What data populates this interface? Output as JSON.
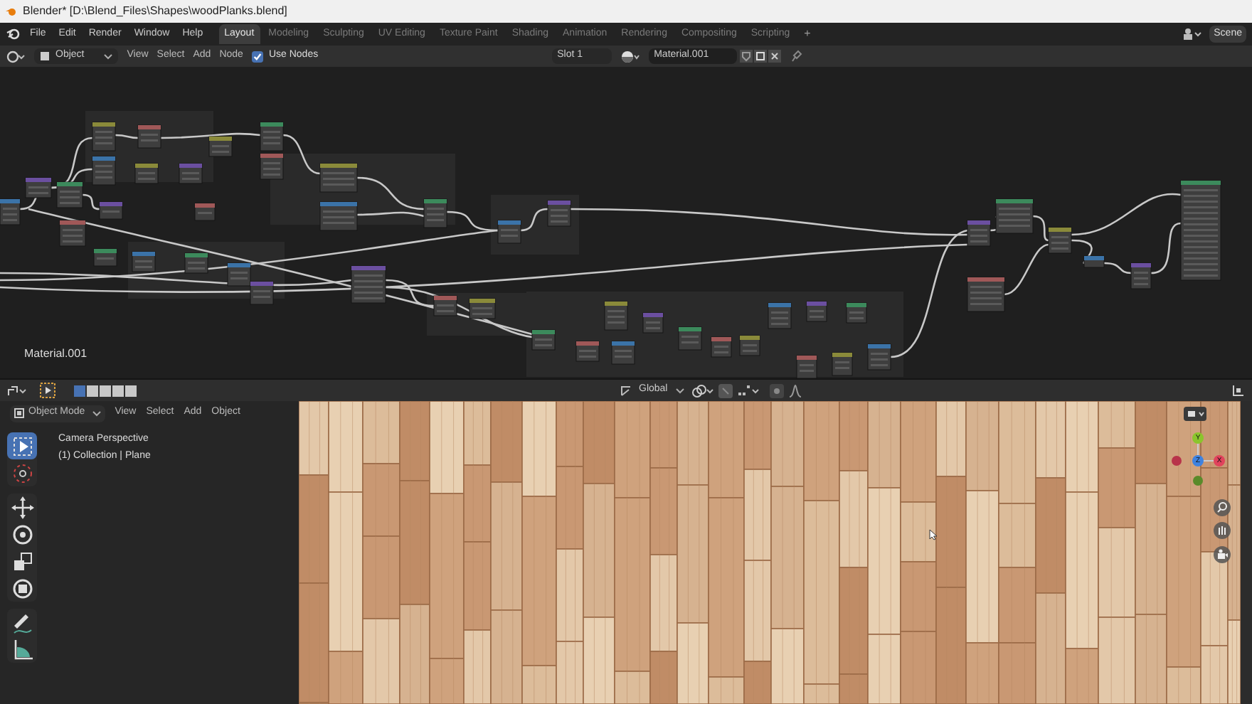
{
  "title_bar": {
    "title": "Blender* [D:\\Blend_Files\\Shapes\\woodPlanks.blend]"
  },
  "menu": [
    "File",
    "Edit",
    "Render",
    "Window",
    "Help"
  ],
  "workspace_tabs": [
    {
      "label": "Layout",
      "selected": true
    },
    {
      "label": "Modeling",
      "selected": false
    },
    {
      "label": "Sculpting",
      "selected": false
    },
    {
      "label": "UV Editing",
      "selected": false
    },
    {
      "label": "Texture Paint",
      "selected": false
    },
    {
      "label": "Shading",
      "selected": false
    },
    {
      "label": "Animation",
      "selected": false
    },
    {
      "label": "Rendering",
      "selected": false
    },
    {
      "label": "Compositing",
      "selected": false
    },
    {
      "label": "Scripting",
      "selected": false
    }
  ],
  "add_tab": "+",
  "scene": "Scene",
  "node_header": {
    "object_type": "Object",
    "menus": [
      "View",
      "Select",
      "Add",
      "Node"
    ],
    "use_nodes": {
      "label": "Use Nodes",
      "checked": true
    },
    "slot": "Slot 1",
    "material": "Material.001"
  },
  "node_editor": {
    "material_label": "Material.001"
  },
  "tool_header": {
    "select_modes": [
      {
        "selected": true
      },
      {
        "selected": false
      },
      {
        "selected": false
      },
      {
        "selected": false
      },
      {
        "selected": false
      }
    ],
    "orientation": "Global"
  },
  "viewport": {
    "mode": "Object Mode",
    "menus": [
      "View",
      "Select",
      "Add",
      "Object"
    ],
    "view_name": "Camera Perspective",
    "collection": "(1) Collection | Plane",
    "tools": [
      {
        "kind": "select",
        "selected": true
      },
      {
        "kind": "cursor",
        "selected": false
      },
      {
        "kind": "move",
        "selected": false
      },
      {
        "kind": "rotate",
        "selected": false
      },
      {
        "kind": "scale",
        "selected": false
      },
      {
        "kind": "transform",
        "selected": false
      },
      {
        "kind": "annotate",
        "selected": false
      },
      {
        "kind": "measure",
        "selected": false
      }
    ],
    "gizmo_axes": [
      "X",
      "Y",
      "Z"
    ]
  }
}
